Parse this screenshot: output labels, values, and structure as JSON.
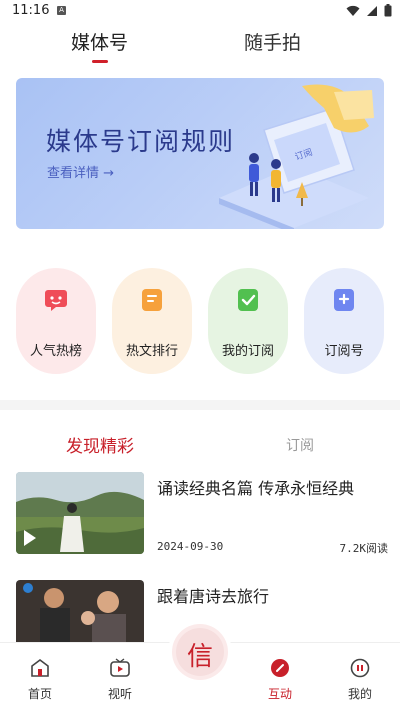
{
  "status_bar": {
    "time": "11:16",
    "badge": "A"
  },
  "top_tabs": [
    {
      "label": "媒体号",
      "active": true
    },
    {
      "label": "随手拍",
      "active": false
    }
  ],
  "banner": {
    "title": "媒体号订阅规则",
    "more_label": "查看详情 →",
    "sign_text": "订阅"
  },
  "categories": [
    {
      "label": "人气热榜",
      "icon": "hot-list-icon",
      "bg": "#fde9ea",
      "color": "#ef4d58"
    },
    {
      "label": "热文排行",
      "icon": "article-rank-icon",
      "bg": "#fdf0e0",
      "color": "#f6a13c"
    },
    {
      "label": "我的订阅",
      "icon": "my-subscription-icon",
      "bg": "#e6f4e2",
      "color": "#52c050"
    },
    {
      "label": "订阅号",
      "icon": "subscription-account-icon",
      "bg": "#e7ecfb",
      "color": "#6f86f0"
    }
  ],
  "sub_tabs": [
    {
      "label": "发现精彩",
      "active": true
    },
    {
      "label": "订阅",
      "active": false
    }
  ],
  "articles": [
    {
      "title": "诵读经典名篇    传承永恒经典",
      "date": "2024-09-30",
      "reads": "7.2K阅读"
    },
    {
      "title": "跟着唐诗去旅行",
      "date": "",
      "reads": ""
    }
  ],
  "bottom_nav": [
    {
      "label": "首页",
      "icon": "home-icon",
      "active": false
    },
    {
      "label": "视听",
      "icon": "tv-icon",
      "active": false
    },
    {
      "label": "互动",
      "icon": "interact-icon",
      "active": true
    },
    {
      "label": "我的",
      "icon": "profile-icon",
      "active": false
    }
  ],
  "center_button": {
    "icon": "xin-logo-icon",
    "glyph": "信"
  },
  "colors": {
    "accent": "#c8202a",
    "banner_title": "#2b3a8c"
  }
}
